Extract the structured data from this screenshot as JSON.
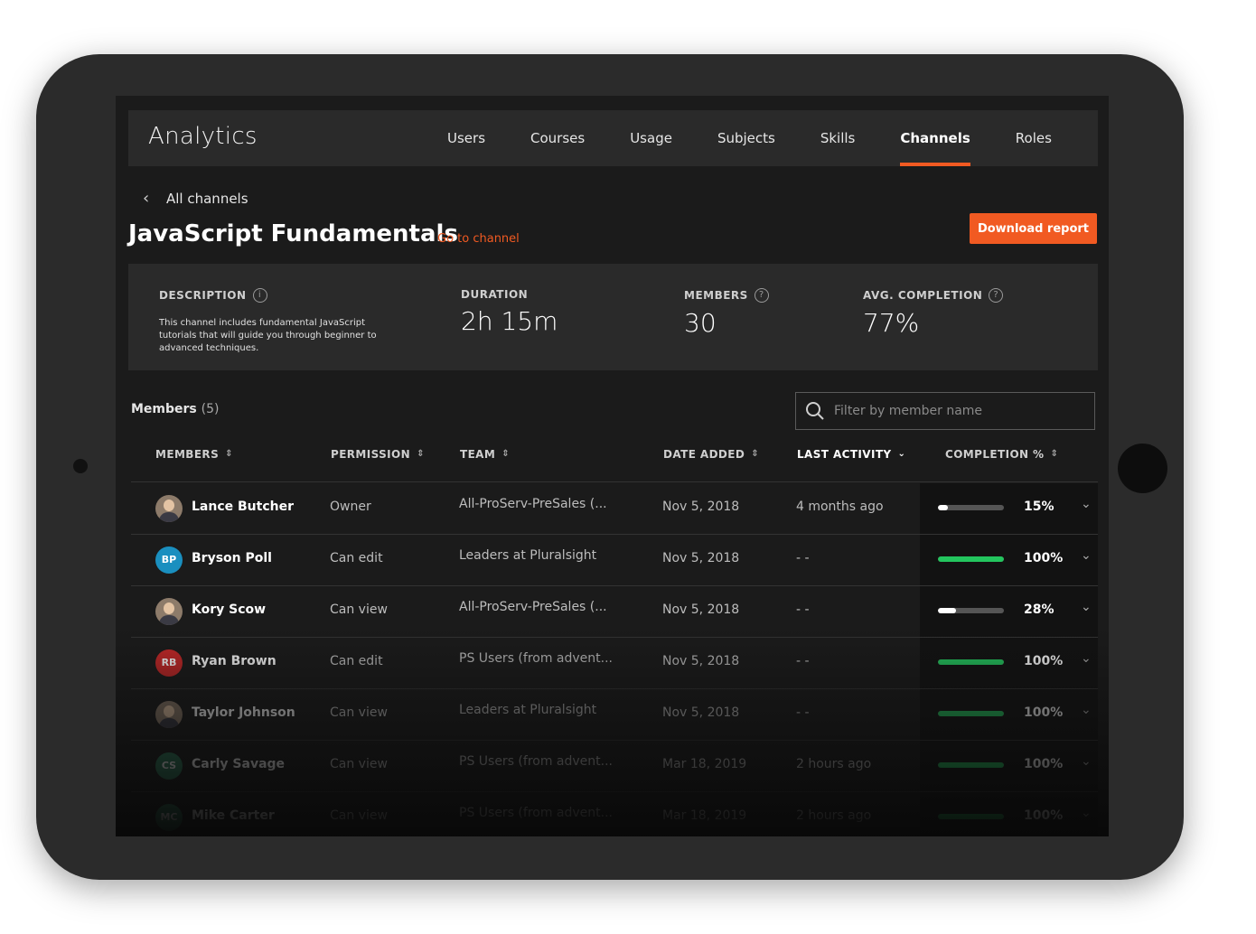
{
  "app": {
    "title": "Analytics"
  },
  "nav": [
    {
      "label": "Users",
      "active": false
    },
    {
      "label": "Courses",
      "active": false
    },
    {
      "label": "Usage",
      "active": false
    },
    {
      "label": "Subjects",
      "active": false
    },
    {
      "label": "Skills",
      "active": false
    },
    {
      "label": "Channels",
      "active": true
    },
    {
      "label": "Roles",
      "active": false
    }
  ],
  "page": {
    "back_label": "All channels",
    "title": "JavaScript Fundamentals",
    "goto_label": "Go to channel",
    "download_label": "Download report"
  },
  "stats": {
    "description": {
      "label": "DESCRIPTION",
      "text": "This channel includes fundamental JavaScript tutorials that will guide you through beginner to advanced techniques."
    },
    "duration": {
      "label": "DURATION",
      "value": "2h 15m"
    },
    "members": {
      "label": "MEMBERS",
      "value": "30"
    },
    "avg_completion": {
      "label": "AVG. COMPLETION",
      "value": "77%"
    }
  },
  "members_section": {
    "label": "Members",
    "count": "(5)",
    "search_placeholder": "Filter by member name"
  },
  "columns": {
    "members": "MEMBERS",
    "permission": "PERMISSION",
    "team": "TEAM",
    "date_added": "DATE ADDED",
    "last_activity": "LAST ACTIVITY",
    "completion": "COMPLETION %"
  },
  "rows": [
    {
      "name": "Lance Butcher",
      "initials": "",
      "avatar_color": "",
      "permission": "Owner",
      "team": "All-ProServ-PreSales (...",
      "date": "Nov 5, 2018",
      "activity": "4 months ago",
      "completion": 15,
      "completion_label": "15%",
      "bar_color": "#ffffff"
    },
    {
      "name": "Bryson Poll",
      "initials": "BP",
      "avatar_color": "#1a8fbf",
      "permission": "Can edit",
      "team": "Leaders at Pluralsight",
      "date": "Nov 5, 2018",
      "activity": "- -",
      "completion": 100,
      "completion_label": "100%",
      "bar_color": "#23c55e"
    },
    {
      "name": "Kory Scow",
      "initials": "",
      "avatar_color": "",
      "permission": "Can view",
      "team": "All-ProServ-PreSales (...",
      "date": "Nov 5, 2018",
      "activity": "- -",
      "completion": 28,
      "completion_label": "28%",
      "bar_color": "#ffffff"
    },
    {
      "name": "Ryan Brown",
      "initials": "RB",
      "avatar_color": "#c62828",
      "permission": "Can edit",
      "team": "PS Users (from advent...",
      "date": "Nov 5, 2018",
      "activity": "- -",
      "completion": 100,
      "completion_label": "100%",
      "bar_color": "#23c55e"
    },
    {
      "name": "Taylor Johnson",
      "initials": "",
      "avatar_color": "",
      "permission": "Can view",
      "team": "Leaders at Pluralsight",
      "date": "Nov 5, 2018",
      "activity": "- -",
      "completion": 100,
      "completion_label": "100%",
      "bar_color": "#23c55e"
    },
    {
      "name": "Carly Savage",
      "initials": "CS",
      "avatar_color": "#2e7d5b",
      "permission": "Can view",
      "team": "PS Users (from advent...",
      "date": "Mar 18, 2019",
      "activity": "2 hours ago",
      "completion": 100,
      "completion_label": "100%",
      "bar_color": "#23c55e"
    },
    {
      "name": "Mike Carter",
      "initials": "MC",
      "avatar_color": "#2e7d5b",
      "permission": "Can view",
      "team": "PS Users (from advent...",
      "date": "Mar 18, 2019",
      "activity": "2 hours ago",
      "completion": 100,
      "completion_label": "100%",
      "bar_color": "#23c55e"
    }
  ]
}
